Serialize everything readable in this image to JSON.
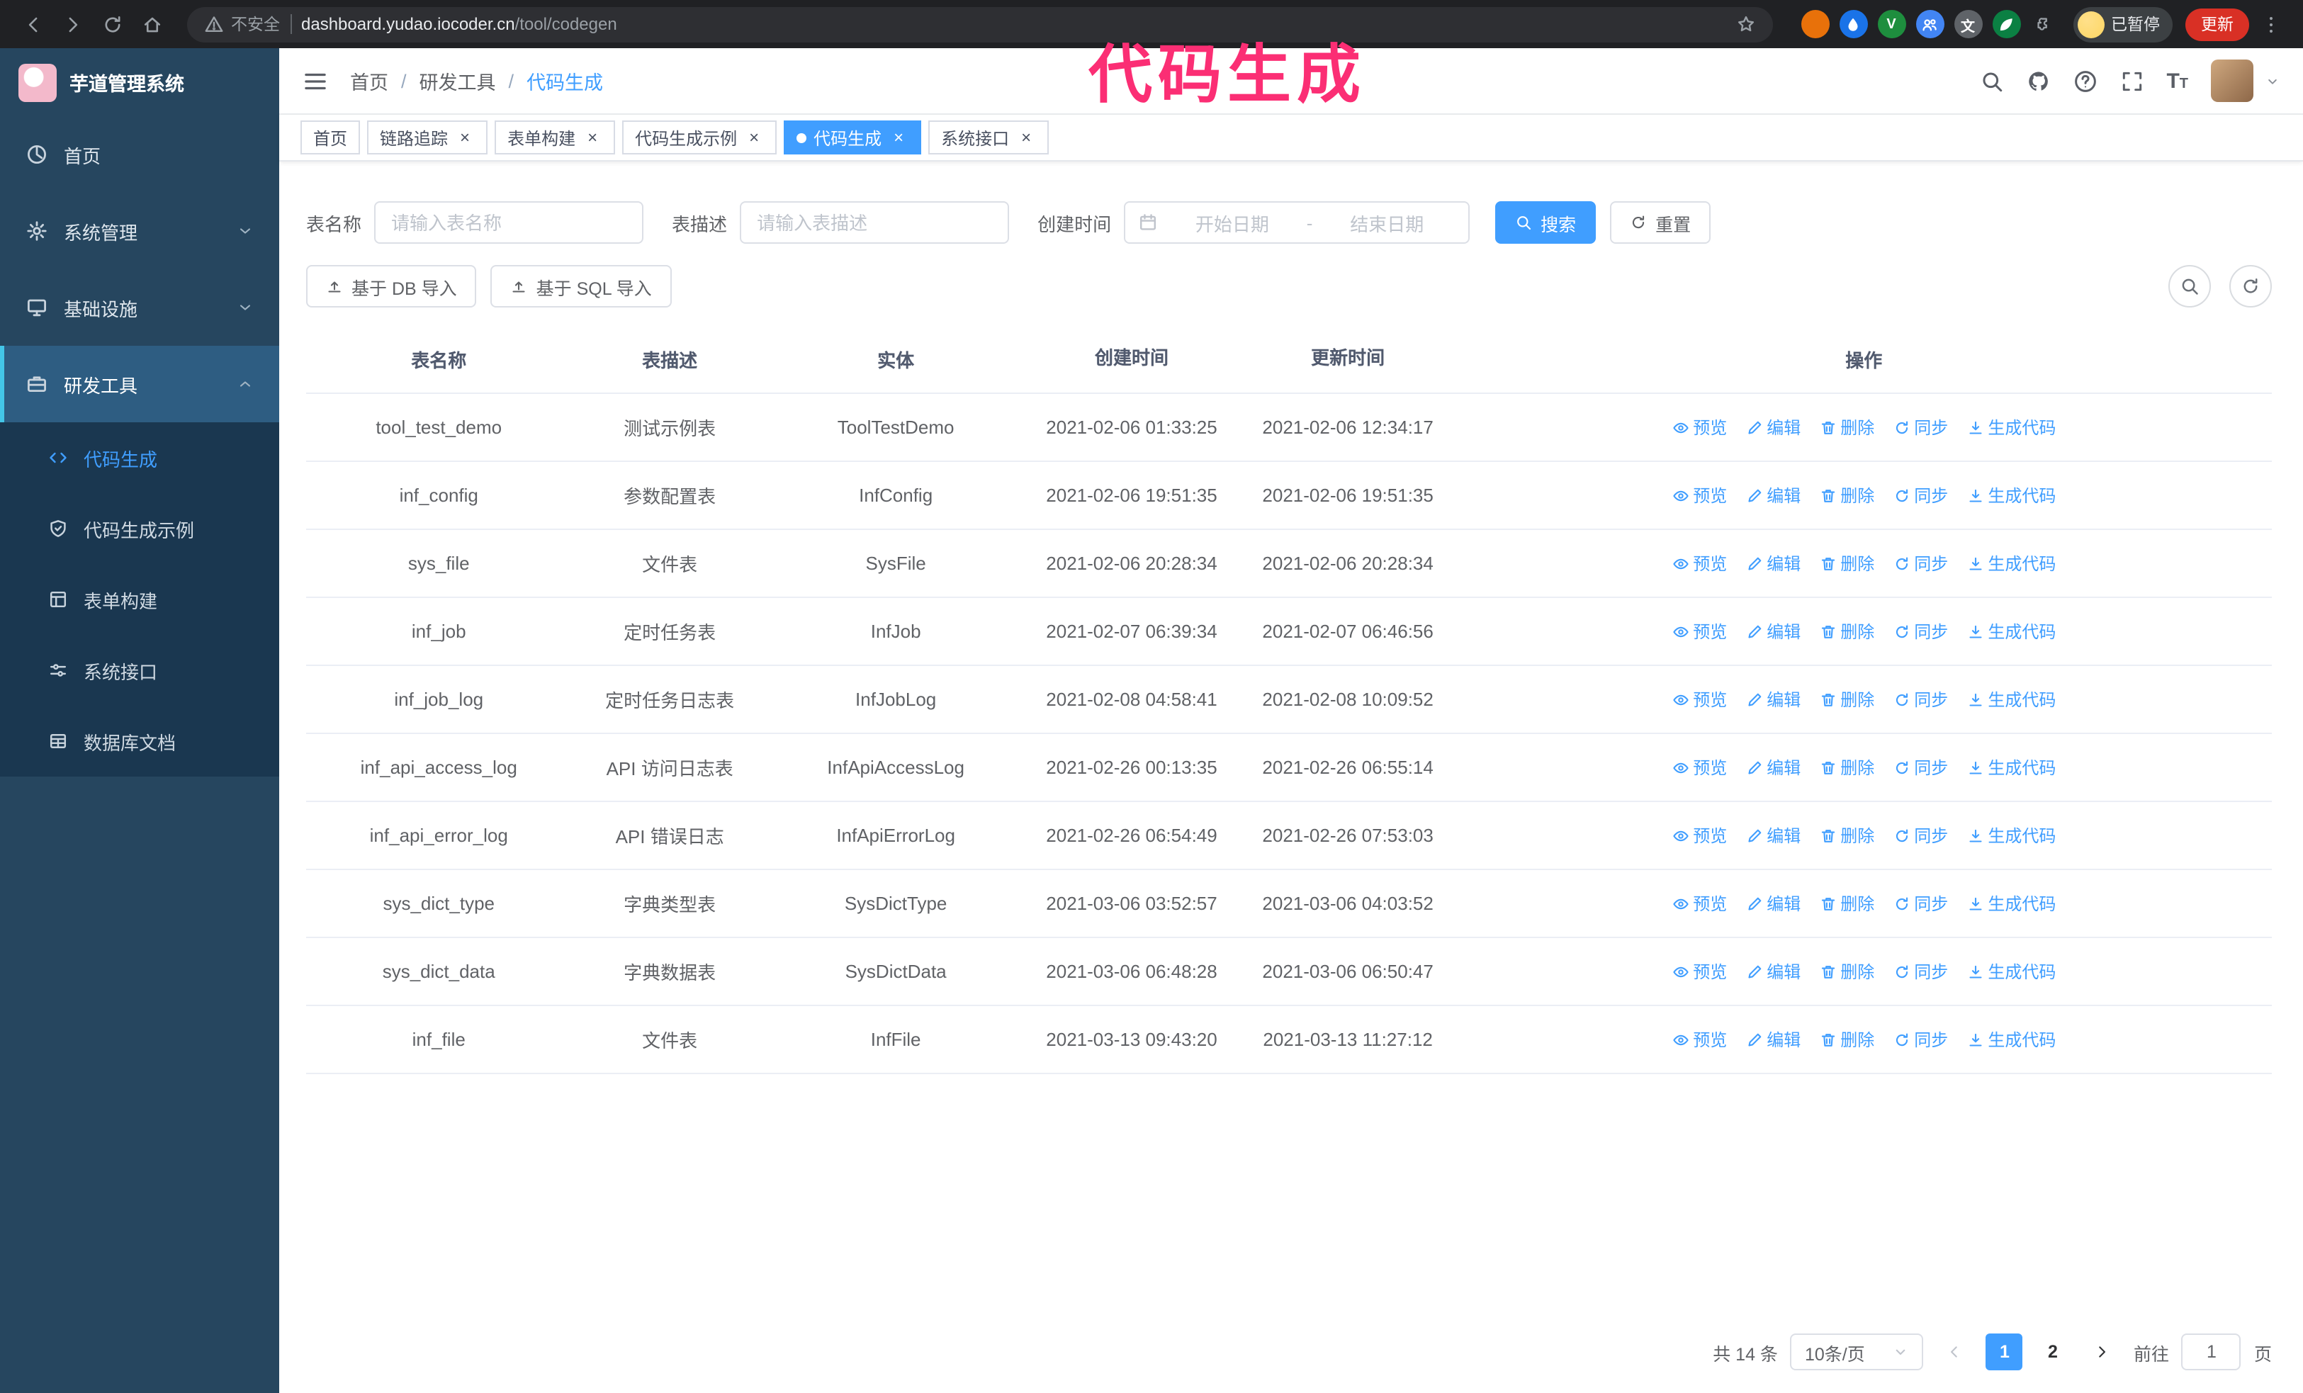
{
  "browser": {
    "security_label": "不安全",
    "url_host": "dashboard.yudao.iocoder.cn",
    "url_path": "/tool/codegen",
    "profile_chip": "已暂停",
    "update_button": "更新",
    "extensions": [
      {
        "name": "extension-orange",
        "color": "#e8710a"
      },
      {
        "name": "extension-drop",
        "color": "#1a73e8",
        "icon": "drop"
      },
      {
        "name": "extension-v",
        "color": "#1e8e3e",
        "glyph": "V"
      },
      {
        "name": "extension-people",
        "color": "#4285f4",
        "icon": "people"
      },
      {
        "name": "extension-translate",
        "color": "#5f6368",
        "glyph": "文"
      },
      {
        "name": "extension-leaf",
        "color": "#0b8043",
        "icon": "leaf"
      },
      {
        "name": "extension-puzzle",
        "color": "transparent",
        "icon": "puzzle",
        "outline": true
      }
    ]
  },
  "annotation": {
    "text": "代码生成",
    "color": "#fb2e74"
  },
  "sidebar": {
    "logo_title": "芋道管理系统",
    "items": [
      {
        "id": "home",
        "label": "首页",
        "icon": "dashboard"
      },
      {
        "id": "system-manage",
        "label": "系统管理",
        "icon": "gear",
        "expandable": true
      },
      {
        "id": "infrastructure",
        "label": "基础设施",
        "icon": "monitor",
        "expandable": true
      },
      {
        "id": "dev-tools",
        "label": "研发工具",
        "icon": "toolbox",
        "expandable": true,
        "expanded": true
      }
    ],
    "sub_items": [
      {
        "id": "codegen",
        "label": "代码生成",
        "icon": "code",
        "active": true
      },
      {
        "id": "codegen-demo",
        "label": "代码生成示例",
        "icon": "shield-check"
      },
      {
        "id": "form-builder",
        "label": "表单构建",
        "icon": "form"
      },
      {
        "id": "system-api",
        "label": "系统接口",
        "icon": "sliders"
      },
      {
        "id": "db-doc",
        "label": "数据库文档",
        "icon": "table-grid"
      }
    ]
  },
  "header": {
    "breadcrumb": [
      "首页",
      "研发工具",
      "代码生成"
    ]
  },
  "tabs": [
    {
      "id": "home",
      "label": "首页",
      "closable": false
    },
    {
      "id": "link-tracer",
      "label": "链路追踪",
      "closable": true
    },
    {
      "id": "form-builder",
      "label": "表单构建",
      "closable": true
    },
    {
      "id": "codegen-demo",
      "label": "代码生成示例",
      "closable": true
    },
    {
      "id": "codegen",
      "label": "代码生成",
      "closable": true,
      "active": true
    },
    {
      "id": "system-api",
      "label": "系统接口",
      "closable": true
    }
  ],
  "filters": {
    "table_name_label": "表名称",
    "table_name_placeholder": "请输入表名称",
    "table_desc_label": "表描述",
    "table_desc_placeholder": "请输入表描述",
    "create_time_label": "创建时间",
    "date_start_placeholder": "开始日期",
    "date_separator": "-",
    "date_end_placeholder": "结束日期",
    "search_label": "搜索",
    "reset_label": "重置"
  },
  "toolbar": {
    "import_db_label": "基于 DB 导入",
    "import_sql_label": "基于 SQL 导入"
  },
  "table": {
    "columns": [
      "表名称",
      "表描述",
      "实体",
      "创建时间",
      "更新时间",
      "操作"
    ],
    "actions": [
      {
        "id": "preview",
        "label": "预览",
        "icon": "eye"
      },
      {
        "id": "edit",
        "label": "编辑",
        "icon": "edit"
      },
      {
        "id": "delete",
        "label": "删除",
        "icon": "trash"
      },
      {
        "id": "sync",
        "label": "同步",
        "icon": "sync"
      },
      {
        "id": "generate-code",
        "label": "生成代码",
        "icon": "download"
      }
    ],
    "rows": [
      {
        "name": "tool_test_demo",
        "desc": "测试示例表",
        "entity": "ToolTestDemo",
        "created": "2021-02-06 01:33:25",
        "updated": "2021-02-06 12:34:17"
      },
      {
        "name": "inf_config",
        "desc": "参数配置表",
        "entity": "InfConfig",
        "created": "2021-02-06 19:51:35",
        "updated": "2021-02-06 19:51:35"
      },
      {
        "name": "sys_file",
        "desc": "文件表",
        "entity": "SysFile",
        "created": "2021-02-06 20:28:34",
        "updated": "2021-02-06 20:28:34"
      },
      {
        "name": "inf_job",
        "desc": "定时任务表",
        "entity": "InfJob",
        "created": "2021-02-07 06:39:34",
        "updated": "2021-02-07 06:46:56"
      },
      {
        "name": "inf_job_log",
        "desc": "定时任务日志表",
        "entity": "InfJobLog",
        "created": "2021-02-08 04:58:41",
        "updated": "2021-02-08 10:09:52"
      },
      {
        "name": "inf_api_access_log",
        "desc": "API 访问日志表",
        "entity": "InfApiAccessLog",
        "created": "2021-02-26 00:13:35",
        "updated": "2021-02-26 06:55:14"
      },
      {
        "name": "inf_api_error_log",
        "desc": "API 错误日志",
        "entity": "InfApiErrorLog",
        "created": "2021-02-26 06:54:49",
        "updated": "2021-02-26 07:53:03"
      },
      {
        "name": "sys_dict_type",
        "desc": "字典类型表",
        "entity": "SysDictType",
        "created": "2021-03-06 03:52:57",
        "updated": "2021-03-06 04:03:52"
      },
      {
        "name": "sys_dict_data",
        "desc": "字典数据表",
        "entity": "SysDictData",
        "created": "2021-03-06 06:48:28",
        "updated": "2021-03-06 06:50:47"
      },
      {
        "name": "inf_file",
        "desc": "文件表",
        "entity": "InfFile",
        "created": "2021-03-13 09:43:20",
        "updated": "2021-03-13 11:27:12"
      }
    ]
  },
  "pagination": {
    "total": "共 14 条",
    "page_size": "10条/页",
    "pages": [
      "1",
      "2"
    ],
    "active_page": "1",
    "goto_label": "前往",
    "goto_value": "1",
    "page_unit": "页"
  },
  "colors": {
    "primary": "#409eff",
    "sidebar_bg": "#26465f",
    "submenu_bg": "#1a3750",
    "annotation": "#fb2e74"
  }
}
